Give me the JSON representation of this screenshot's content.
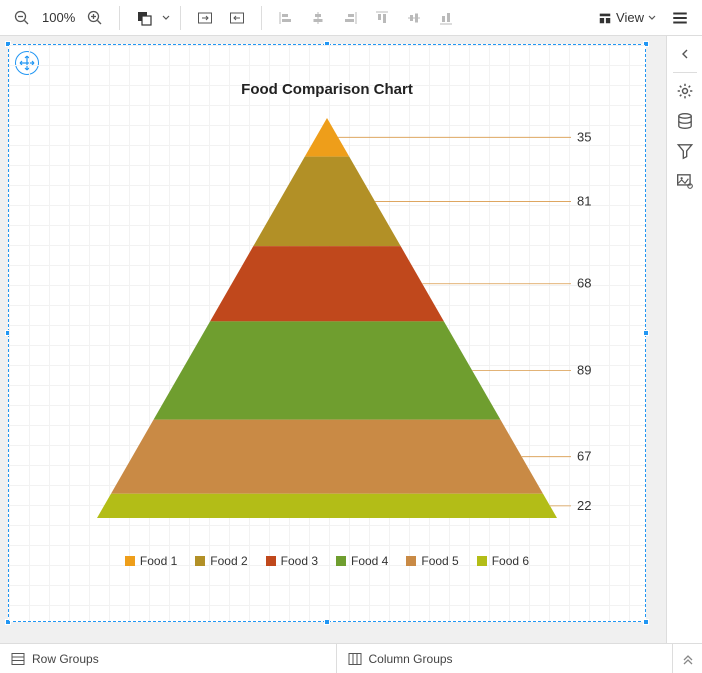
{
  "toolbar": {
    "zoom_level": "100%",
    "view_label": "View"
  },
  "bottom": {
    "row_groups": "Row Groups",
    "column_groups": "Column Groups"
  },
  "chart_data": {
    "type": "pyramid",
    "title": "Food Comparison Chart",
    "series": [
      {
        "name": "Food 1",
        "value": 35,
        "color": "#ee9e1a"
      },
      {
        "name": "Food 2",
        "value": 81,
        "color": "#b29026"
      },
      {
        "name": "Food 3",
        "value": 68,
        "color": "#c0481c"
      },
      {
        "name": "Food 4",
        "value": 89,
        "color": "#6f9e2f"
      },
      {
        "name": "Food 5",
        "value": 67,
        "color": "#c98a45"
      },
      {
        "name": "Food 6",
        "value": 22,
        "color": "#b3bd17"
      }
    ]
  }
}
